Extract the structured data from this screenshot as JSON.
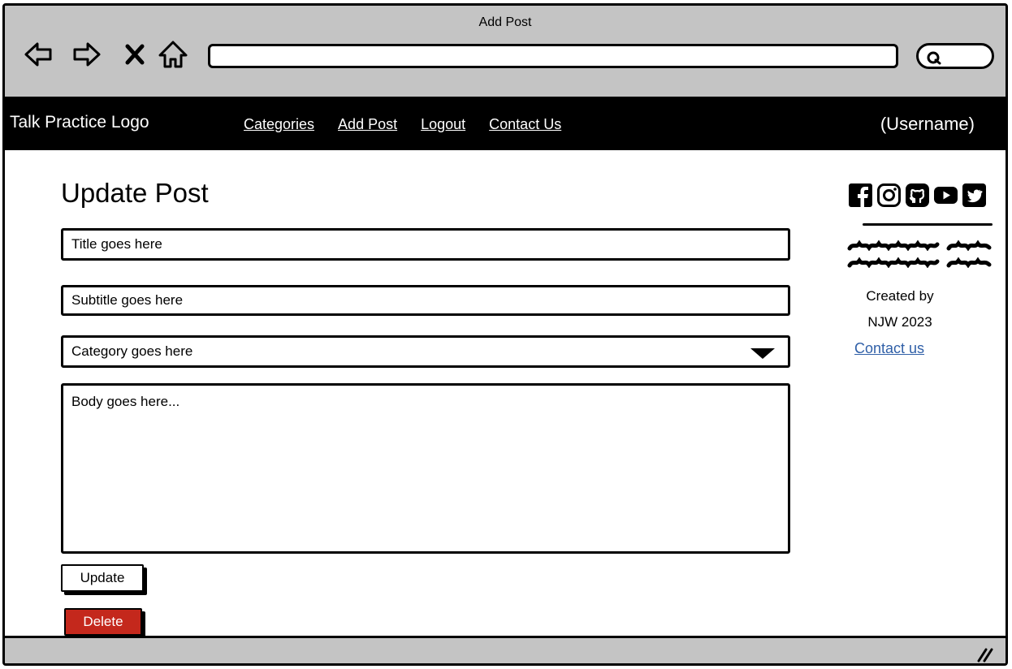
{
  "window": {
    "title": "Add Post"
  },
  "browser": {
    "back_icon": "back-arrow-icon",
    "forward_icon": "forward-arrow-icon",
    "stop_icon": "close-x-icon",
    "home_icon": "home-icon",
    "address_value": "",
    "search_icon": "search-icon"
  },
  "navbar": {
    "logo": "Talk Practice Logo",
    "links": [
      "Categories",
      "Add Post",
      "Logout",
      "Contact Us"
    ],
    "username": "(Username)"
  },
  "form": {
    "heading": "Update Post",
    "title_placeholder": "Title goes here",
    "subtitle_placeholder": "Subtitle goes here",
    "category_value": "Category goes here",
    "body_placeholder": "Body goes here...",
    "update_label": "Update",
    "delete_label": "Delete"
  },
  "sidebar": {
    "social_icons": [
      "facebook-icon",
      "instagram-icon",
      "github-icon",
      "youtube-icon",
      "twitter-icon"
    ],
    "credit_line1": "Created by",
    "credit_line2": "NJW 2023",
    "contact_link": "Contact us"
  },
  "colors": {
    "chrome": "#c4c4c4",
    "navbar": "#000000",
    "delete": "#c4281c",
    "link": "#2f5fa7"
  }
}
